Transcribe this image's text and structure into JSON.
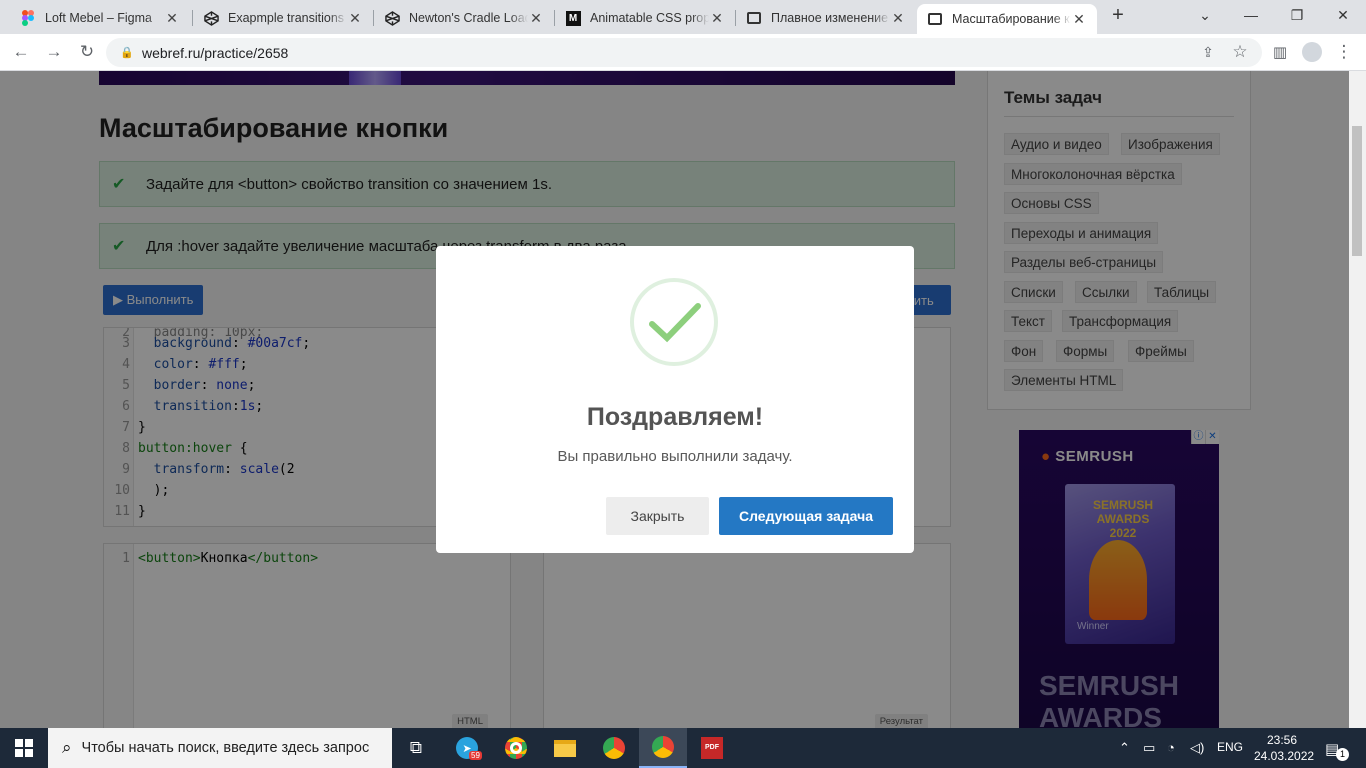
{
  "browser": {
    "tabs": [
      {
        "title": "Loft Mebel – Figma",
        "icon": "figma-icon"
      },
      {
        "title": "Exapmple transitions c",
        "icon": "codepen-icon"
      },
      {
        "title": "Newton's Cradle Load",
        "icon": "codepen-icon"
      },
      {
        "title": "Animatable CSS prope",
        "icon": "mdn-icon"
      },
      {
        "title": "Плавное изменение ",
        "icon": "webref-icon"
      },
      {
        "title": "Масштабирование кн",
        "icon": "webref-icon"
      }
    ],
    "active_tab_index": 5,
    "url": "webref.ru/practice/2658"
  },
  "page": {
    "task_title": "Масштабирование кнопки",
    "requirements": [
      "Задайте для <button> свойство transition со значением 1s.",
      "Для :hover задайте увеличение масштаба через transform в два раза."
    ],
    "run_label": "▶ Выполнить",
    "reset_label": "Сбросить",
    "css_editor_lines": [
      {
        "n": "3",
        "text": "  background: #00a7cf;"
      },
      {
        "n": "4",
        "text": "  color: #fff;"
      },
      {
        "n": "5",
        "text": "  border: none;"
      },
      {
        "n": "6",
        "text": "  transition:1s;"
      },
      {
        "n": "7",
        "text": "}"
      },
      {
        "n": "8",
        "text": "button:hover {"
      },
      {
        "n": "9",
        "text": "  transform: scale(2"
      },
      {
        "n": "10",
        "text": "  );"
      },
      {
        "n": "11",
        "text": "}"
      }
    ],
    "html_editor_lines": [
      {
        "n": "1",
        "text": "<button>Кнопка</button>"
      }
    ],
    "html_label": "HTML",
    "result_label": "Результат"
  },
  "sidebar": {
    "title": "Темы задач",
    "topics": [
      "Аудио и видео",
      "Изображения",
      "Многоколоночная вёрстка",
      "Основы CSS",
      "Переходы и анимация",
      "Разделы веб-страницы",
      "Списки",
      "Ссылки",
      "Таблицы",
      "Текст",
      "Трансформация",
      "Фон",
      "Формы",
      "Фреймы",
      "Элементы HTML"
    ]
  },
  "ad": {
    "brand": "SEMRUSH",
    "trophy_text": "SEMRUSH AWARDS 2022",
    "winner": "Winner",
    "headline": "SEMRUSH AWARDS"
  },
  "modal": {
    "title": "Поздравляем!",
    "message": "Вы правильно выполнили задачу.",
    "close_label": "Закрыть",
    "next_label": "Следующая задача"
  },
  "taskbar": {
    "search_placeholder": "Чтобы начать поиск, введите здесь запрос",
    "telegram_badge": "59",
    "language": "ENG",
    "time": "23:56",
    "date": "24.03.2022",
    "notifications": "1"
  },
  "colors": {
    "accent_blue": "#2478c4",
    "success_green": "#4cae4c",
    "requirement_bg": "#ddf0e1"
  }
}
